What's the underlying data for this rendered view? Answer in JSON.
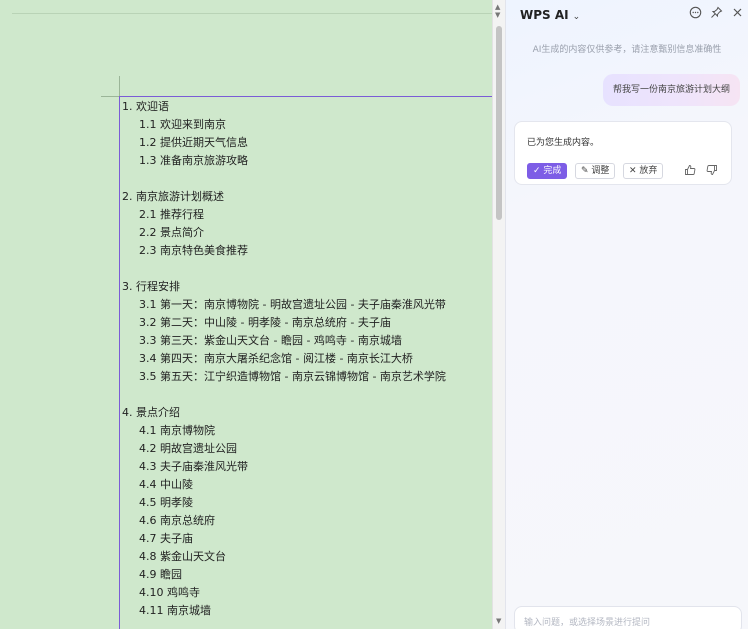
{
  "document": {
    "lines": [
      {
        "level": 1,
        "text": "1. 欢迎语"
      },
      {
        "level": 2,
        "text": "1.1 欢迎来到南京"
      },
      {
        "level": 2,
        "text": "1.2 提供近期天气信息"
      },
      {
        "level": 2,
        "text": "1.3 准备南京旅游攻略"
      },
      {
        "level": 0,
        "text": ""
      },
      {
        "level": 1,
        "text": "2. 南京旅游计划概述"
      },
      {
        "level": 2,
        "text": "2.1 推荐行程"
      },
      {
        "level": 2,
        "text": "2.2 景点简介"
      },
      {
        "level": 2,
        "text": "2.3 南京特色美食推荐"
      },
      {
        "level": 0,
        "text": ""
      },
      {
        "level": 1,
        "text": "3. 行程安排"
      },
      {
        "level": 2,
        "text": "3.1 第一天：南京博物院 - 明故宫遗址公园 - 夫子庙秦淮风光带"
      },
      {
        "level": 2,
        "text": "3.2 第二天：中山陵 - 明孝陵 - 南京总统府 - 夫子庙"
      },
      {
        "level": 2,
        "text": "3.3 第三天：紫金山天文台 - 瞻园 - 鸡鸣寺 - 南京城墙"
      },
      {
        "level": 2,
        "text": "3.4 第四天：南京大屠杀纪念馆 - 阅江楼 - 南京长江大桥"
      },
      {
        "level": 2,
        "text": "3.5 第五天：江宁织造博物馆 - 南京云锦博物馆 - 南京艺术学院"
      },
      {
        "level": 0,
        "text": ""
      },
      {
        "level": 1,
        "text": "4. 景点介绍"
      },
      {
        "level": 2,
        "text": "4.1 南京博物院"
      },
      {
        "level": 2,
        "text": "4.2 明故宫遗址公园"
      },
      {
        "level": 2,
        "text": "4.3 夫子庙秦淮风光带"
      },
      {
        "level": 2,
        "text": "4.4 中山陵"
      },
      {
        "level": 2,
        "text": "4.5 明孝陵"
      },
      {
        "level": 2,
        "text": "4.6 南京总统府"
      },
      {
        "level": 2,
        "text": "4.7 夫子庙"
      },
      {
        "level": 2,
        "text": "4.8 紫金山天文台"
      },
      {
        "level": 2,
        "text": "4.9 瞻园"
      },
      {
        "level": 2,
        "text": "4.10 鸡鸣寺"
      },
      {
        "level": 2,
        "text": "4.11 南京城墙"
      }
    ]
  },
  "ai_panel": {
    "title": "WPS AI",
    "title_chevron": "⌄",
    "disclaimer": "AI生成的内容仅供参考，请注意甄别信息准确性",
    "user_message": "帮我写一份南京旅游计划大纲",
    "response_text": "已为您生成内容。",
    "buttons": {
      "done": "✓ 完成",
      "adjust": "✎ 调整",
      "discard": "✕ 放弃"
    },
    "input_placeholder": "输入问题，或选择场景进行提问",
    "icons": {
      "chat": "chat-icon",
      "pin": "pin-icon",
      "close": "close-icon",
      "thumbs_up": "thumbs-up-icon",
      "thumbs_down": "thumbs-down-icon"
    }
  },
  "colors": {
    "doc_background": "#cfe8cc",
    "accent": "#7d5de6",
    "selection_border": "#7b5cd6"
  }
}
